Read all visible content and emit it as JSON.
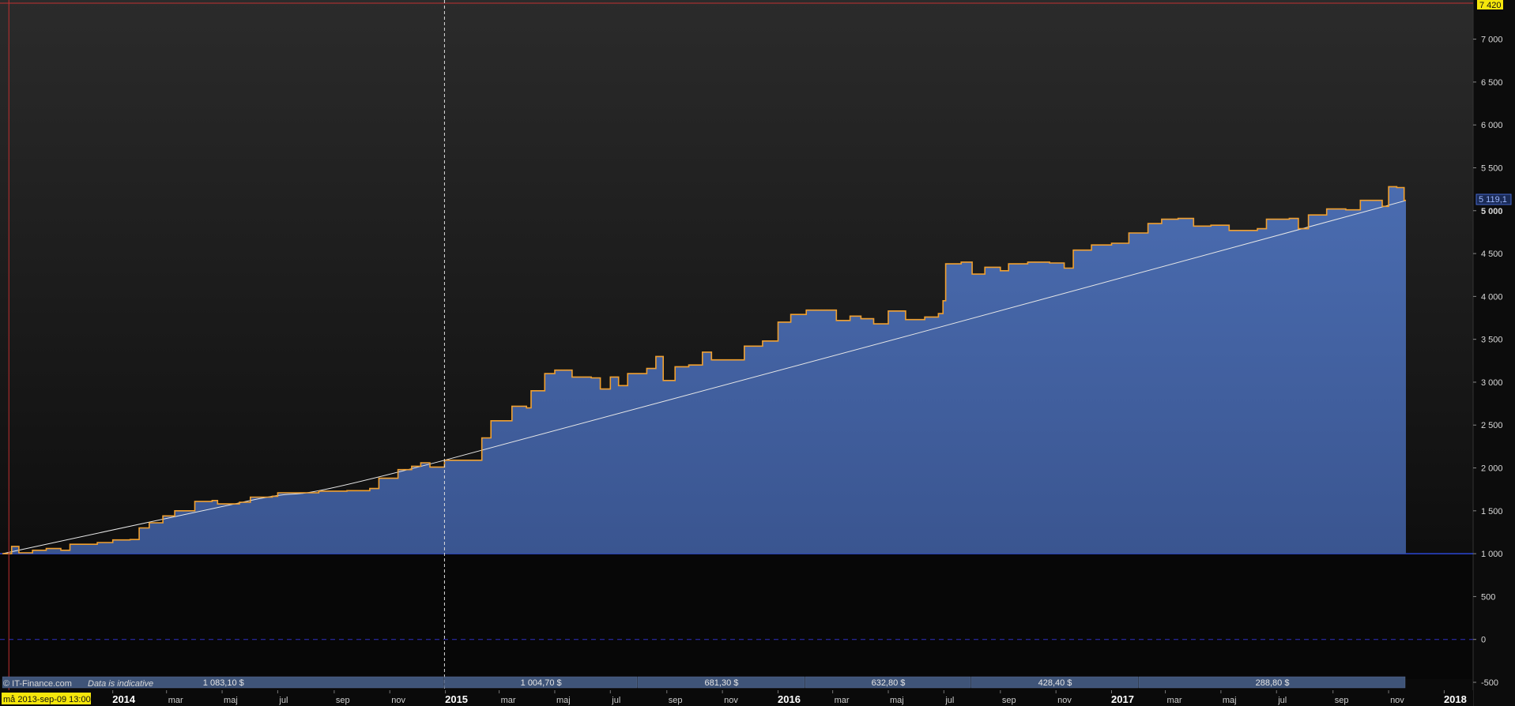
{
  "credit": {
    "copyright": "© IT-Finance.com",
    "note": "Data is indicative"
  },
  "cursor_date": "må 2013-sep-09 13:00",
  "current_value_label": "5 119,1",
  "top_value_label": "7 420",
  "chart_data": {
    "type": "area",
    "x_axis": {
      "type": "date",
      "range": [
        "2013-09-01",
        "2018-01-31"
      ],
      "ticks": [
        {
          "date": "2014-01-01",
          "label": "2014",
          "year": true
        },
        {
          "date": "2014-03-01",
          "label": "mar"
        },
        {
          "date": "2014-05-01",
          "label": "maj"
        },
        {
          "date": "2014-07-01",
          "label": "jul"
        },
        {
          "date": "2014-09-01",
          "label": "sep"
        },
        {
          "date": "2014-11-01",
          "label": "nov"
        },
        {
          "date": "2015-01-01",
          "label": "2015",
          "year": true
        },
        {
          "date": "2015-03-01",
          "label": "mar"
        },
        {
          "date": "2015-05-01",
          "label": "maj"
        },
        {
          "date": "2015-07-01",
          "label": "jul"
        },
        {
          "date": "2015-09-01",
          "label": "sep"
        },
        {
          "date": "2015-11-01",
          "label": "nov"
        },
        {
          "date": "2016-01-01",
          "label": "2016",
          "year": true
        },
        {
          "date": "2016-03-01",
          "label": "mar"
        },
        {
          "date": "2016-05-01",
          "label": "maj"
        },
        {
          "date": "2016-07-01",
          "label": "jul"
        },
        {
          "date": "2016-09-01",
          "label": "sep"
        },
        {
          "date": "2016-11-01",
          "label": "nov"
        },
        {
          "date": "2017-01-01",
          "label": "2017",
          "year": true
        },
        {
          "date": "2017-03-01",
          "label": "mar"
        },
        {
          "date": "2017-05-01",
          "label": "maj"
        },
        {
          "date": "2017-07-01",
          "label": "jul"
        },
        {
          "date": "2017-09-01",
          "label": "sep"
        },
        {
          "date": "2017-11-01",
          "label": "nov"
        },
        {
          "date": "2018-01-01",
          "label": "2018",
          "year": true
        }
      ]
    },
    "y_axis": {
      "range": [
        -500,
        7420
      ],
      "ticks": [
        {
          "value": 7000,
          "label": "7 000"
        },
        {
          "value": 6500,
          "label": "6 500"
        },
        {
          "value": 6000,
          "label": "6 000"
        },
        {
          "value": 5500,
          "label": "5 500"
        },
        {
          "value": 5000,
          "label": "5 000",
          "bold": true
        },
        {
          "value": 4500,
          "label": "4 500"
        },
        {
          "value": 4000,
          "label": "4 000"
        },
        {
          "value": 3500,
          "label": "3 500"
        },
        {
          "value": 3000,
          "label": "3 000"
        },
        {
          "value": 2500,
          "label": "2 500"
        },
        {
          "value": 2000,
          "label": "2 000"
        },
        {
          "value": 1500,
          "label": "1 500"
        },
        {
          "value": 1000,
          "label": "1 000"
        },
        {
          "value": 500,
          "label": "500"
        },
        {
          "value": 0,
          "label": "0"
        },
        {
          "value": -500,
          "label": "-500"
        }
      ]
    },
    "baseline": 1000,
    "zero_line": 0,
    "top_line": 7420,
    "vertical_markers": [
      "2013-09-09",
      "2014-12-31"
    ],
    "equity_series": [
      [
        "2013-09-02",
        1000
      ],
      [
        "2013-09-12",
        1085
      ],
      [
        "2013-09-20",
        1010
      ],
      [
        "2013-10-05",
        1040
      ],
      [
        "2013-10-20",
        1060
      ],
      [
        "2013-11-05",
        1040
      ],
      [
        "2013-11-15",
        1110
      ],
      [
        "2013-12-15",
        1130
      ],
      [
        "2014-01-01",
        1160
      ],
      [
        "2014-01-20",
        1165
      ],
      [
        "2014-01-30",
        1300
      ],
      [
        "2014-02-10",
        1360
      ],
      [
        "2014-02-25",
        1440
      ],
      [
        "2014-03-10",
        1500
      ],
      [
        "2014-03-25",
        1500
      ],
      [
        "2014-04-01",
        1610
      ],
      [
        "2014-04-20",
        1620
      ],
      [
        "2014-04-26",
        1580
      ],
      [
        "2014-05-20",
        1600
      ],
      [
        "2014-06-01",
        1660
      ],
      [
        "2014-06-25",
        1670
      ],
      [
        "2014-07-01",
        1710
      ],
      [
        "2014-08-15",
        1730
      ],
      [
        "2014-09-15",
        1735
      ],
      [
        "2014-10-10",
        1760
      ],
      [
        "2014-10-20",
        1880
      ],
      [
        "2014-11-01",
        1880
      ],
      [
        "2014-11-10",
        1980
      ],
      [
        "2014-11-25",
        2020
      ],
      [
        "2014-12-05",
        2060
      ],
      [
        "2014-12-15",
        2010
      ],
      [
        "2014-12-31",
        2090
      ],
      [
        "2015-01-31",
        2090
      ],
      [
        "2015-02-10",
        2350
      ],
      [
        "2015-02-20",
        2550
      ],
      [
        "2015-03-01",
        2550
      ],
      [
        "2015-03-15",
        2720
      ],
      [
        "2015-03-31",
        2700
      ],
      [
        "2015-04-05",
        2900
      ],
      [
        "2015-04-20",
        3100
      ],
      [
        "2015-05-01",
        3140
      ],
      [
        "2015-05-20",
        3060
      ],
      [
        "2015-06-10",
        3050
      ],
      [
        "2015-06-20",
        2920
      ],
      [
        "2015-07-01",
        3060
      ],
      [
        "2015-07-10",
        2960
      ],
      [
        "2015-07-20",
        3100
      ],
      [
        "2015-08-10",
        3160
      ],
      [
        "2015-08-20",
        3300
      ],
      [
        "2015-08-28",
        3020
      ],
      [
        "2015-09-10",
        3180
      ],
      [
        "2015-09-25",
        3200
      ],
      [
        "2015-10-10",
        3350
      ],
      [
        "2015-10-20",
        3260
      ],
      [
        "2015-11-10",
        3260
      ],
      [
        "2015-11-25",
        3420
      ],
      [
        "2015-12-15",
        3480
      ],
      [
        "2016-01-01",
        3700
      ],
      [
        "2016-01-15",
        3790
      ],
      [
        "2016-02-01",
        3840
      ],
      [
        "2016-02-25",
        3840
      ],
      [
        "2016-03-05",
        3720
      ],
      [
        "2016-03-20",
        3770
      ],
      [
        "2016-04-01",
        3740
      ],
      [
        "2016-04-15",
        3680
      ],
      [
        "2016-05-01",
        3830
      ],
      [
        "2016-05-20",
        3730
      ],
      [
        "2016-06-10",
        3760
      ],
      [
        "2016-06-25",
        3800
      ],
      [
        "2016-06-30",
        3950
      ],
      [
        "2016-07-03",
        4380
      ],
      [
        "2016-07-20",
        4400
      ],
      [
        "2016-08-01",
        4260
      ],
      [
        "2016-08-15",
        4340
      ],
      [
        "2016-09-01",
        4300
      ],
      [
        "2016-09-10",
        4380
      ],
      [
        "2016-10-01",
        4400
      ],
      [
        "2016-10-25",
        4390
      ],
      [
        "2016-11-10",
        4330
      ],
      [
        "2016-11-20",
        4540
      ],
      [
        "2016-12-10",
        4600
      ],
      [
        "2017-01-01",
        4620
      ],
      [
        "2017-01-20",
        4740
      ],
      [
        "2017-02-10",
        4850
      ],
      [
        "2017-02-25",
        4900
      ],
      [
        "2017-03-15",
        4910
      ],
      [
        "2017-04-01",
        4820
      ],
      [
        "2017-04-20",
        4830
      ],
      [
        "2017-05-10",
        4770
      ],
      [
        "2017-06-10",
        4790
      ],
      [
        "2017-06-20",
        4900
      ],
      [
        "2017-07-15",
        4910
      ],
      [
        "2017-07-25",
        4790
      ],
      [
        "2017-08-05",
        4950
      ],
      [
        "2017-08-25",
        5020
      ],
      [
        "2017-09-15",
        5010
      ],
      [
        "2017-10-01",
        5120
      ],
      [
        "2017-10-15",
        5120
      ],
      [
        "2017-10-25",
        5050
      ],
      [
        "2017-11-01",
        5280
      ],
      [
        "2017-11-10",
        5270
      ],
      [
        "2017-11-18",
        5120
      ]
    ],
    "trend_series": [
      [
        "2013-09-02",
        1000
      ],
      [
        "2014-06-01",
        1620
      ],
      [
        "2014-12-31",
        2090
      ],
      [
        "2017-11-20",
        5119
      ]
    ],
    "end_date": "2017-11-20",
    "bottom_strip": [
      {
        "start": "2013-09-02",
        "end": "2014-12-31",
        "label": "1 083,10 $"
      },
      {
        "start": "2014-12-31",
        "end": "2015-07-31",
        "label": "1 004,70 $"
      },
      {
        "start": "2015-07-31",
        "end": "2016-01-31",
        "label": "681,30 $"
      },
      {
        "start": "2016-01-31",
        "end": "2016-07-31",
        "label": "632,80 $"
      },
      {
        "start": "2016-07-31",
        "end": "2017-01-31",
        "label": "428,40 $"
      },
      {
        "start": "2017-01-31",
        "end": "2017-11-20",
        "label": "288,80 $"
      }
    ],
    "colors": {
      "fill_top": "#4a6cb0",
      "fill_bottom": "#3a5590",
      "equity_line": "#f0a030",
      "trend_line": "#e8e8e8",
      "baseline": "#3355ff",
      "top_line": "#c03030",
      "marker_line": "#c03030",
      "grid_dashed": "#3030c0",
      "label_highlight": "#f5e60c"
    }
  }
}
